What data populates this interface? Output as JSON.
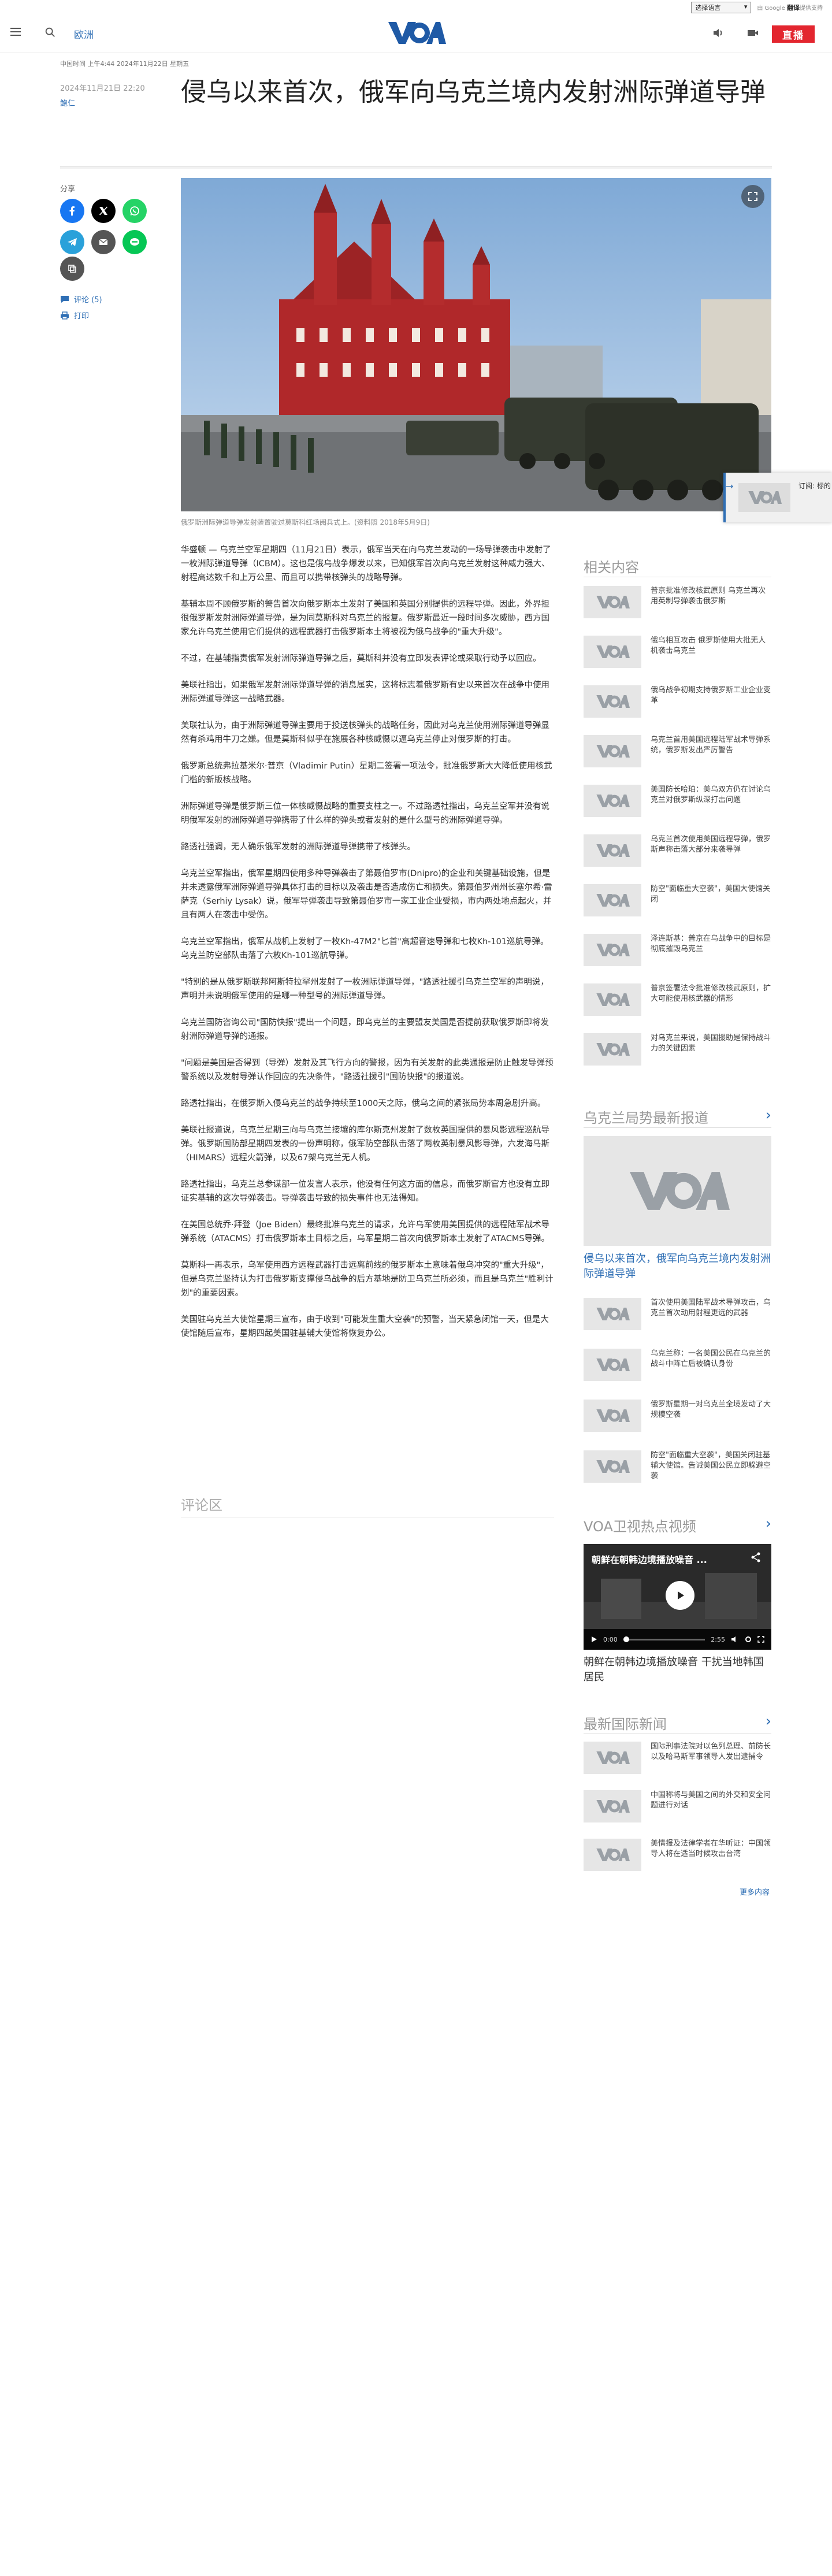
{
  "translate_bar": {
    "select_label": "选择语言",
    "powered": "由 Google ",
    "translate": "翻译",
    "powered_suffix": "提供支持"
  },
  "header": {
    "section": "欧洲",
    "logo": "VOA",
    "live_label": "直播"
  },
  "article": {
    "dateline": "中国时间 上午4:44 2024年11月22日 星期五",
    "date": "2024年11月21日 22:20",
    "author": "鲍仁",
    "title": "侵乌以来首次，俄军向乌克兰境内发射洲际弹道导弹",
    "caption": "俄罗斯洲际弹道导弹发射装置驶过莫斯科红场阅兵式上。(资料照 2018年5月9日)",
    "paragraphs": [
      "华盛顿 — 乌克兰空军星期四（11月21日）表示，俄军当天在向乌克兰发动的一场导弹袭击中发射了一枚洲际弹道导弹（ICBM）。这也是俄乌战争爆发以来，已知俄军首次向乌克兰发射这种威力强大、射程高达数千和上万公里、而且可以携带核弹头的战略导弹。",
      "基辅本周不顾俄罗斯的警告首次向俄罗斯本土发射了美国和英国分别提供的远程导弹。因此，外界担很俄罗斯发射洲际弹道导弹，是为同莫斯科对乌克兰的报复。俄罗斯最近一段时间多次威胁，西方国家允许乌克兰使用它们提供的远程武器打击俄罗斯本土将被视为俄乌战争的\"重大升级\"。",
      "不过，在基辅指责俄军发射洲际弹道导弹之后，莫斯科并没有立即发表评论或采取行动予以回应。",
      "美联社指出，如果俄军发射洲际弹道导弹的消息属实，这将标志着俄罗斯有史以来首次在战争中使用洲际弹道导弹这一战略武器。",
      "美联社认为，由于洲际弹道导弹主要用于投送核弹头的战略任务，因此对乌克兰使用洲际弹道导弹显然有杀鸡用牛刀之嫌。但是莫斯科似乎在施展各种核威慑以逼乌克兰停止对俄罗斯的打击。",
      "俄罗斯总统弗拉基米尔·普京（Vladimir Putin）星期二签署一项法令，批准俄罗斯大大降低使用核武门槛的新版核战略。",
      "洲际弹道导弹是俄罗斯三位一体核威慑战略的重要支柱之一。不过路透社指出，乌克兰空军并没有说明俄军发射的洲际弹道导弹携带了什么样的弹头或者发射的是什么型号的洲际弹道导弹。",
      "路透社强调，无人确乐俄军发射的洲际弹道导弹携带了核弹头。",
      "乌克兰空军指出，俄军星期四使用多种导弹袭击了第聂伯罗市(Dnipro)的企业和关键基础设施，但是并未透露俄军洲际弹道导弹具体打击的目标以及袭击是否造成伤亡和损失。第聂伯罗州州长塞尔希·雷萨克（Serhiy Lysak）说，俄军导弹袭击导致第聂伯罗市一家工业企业受损，市内两处地点起火，并且有两人在袭击中受伤。",
      "乌克兰空军指出，俄军从战机上发射了一枚Kh-47M2\"匕首\"高超音速导弹和七枚Kh-101巡航导弹。乌克兰防空部队击落了六枚Kh-101巡航导弹。",
      "\"特别的是从俄罗斯联邦阿斯特拉罕州发射了一枚洲际弹道导弹，\"路透社援引乌克兰空军的声明说，声明并未说明俄军使用的是哪一种型号的洲际弹道导弹。",
      "乌克兰国防咨询公司\"国防快报\"提出一个问题，即乌克兰的主要盟友美国是否提前获取俄罗斯即将发射洲际弹道导弹的通报。",
      "\"问题是美国是否得到（导弹）发射及其飞行方向的警报，因为有关发射的此类通报是防止触发导弹预警系统以及发射导弹认作回应的先决条件，\"路透社援引\"国防快报\"的报道说。",
      "路透社指出，在俄罗斯入侵乌克兰的战争持续至1000天之际，俄乌之间的紧张局势本周急剧升高。",
      "美联社报道说，乌克兰星期三向与乌克兰接壤的库尔斯克州发射了数枚英国提供的暴风影远程巡航导弹。俄罗斯国防部星期四发表的一份声明称，俄军防空部队击落了两枚英制暴风影导弹，六发海马斯（HIMARS）远程火箭弹，以及67架乌克兰无人机。",
      "路透社指出，乌克兰总参谋部一位发言人表示，他没有任何这方面的信息，而俄罗斯官方也没有立即证实基辅的这次导弹袭击。导弹袭击导致的损失事件也无法得知。",
      "在美国总统乔·拜登（Joe Biden）最终批准乌克兰的请求，允许乌军使用美国提供的远程陆军战术导弹系统（ATACMS）打击俄罗斯本土目标之后，乌军星期二首次向俄罗斯本土发射了ATACMS导弹。",
      "莫斯科一再表示，乌军使用西方远程武器打击远离前线的俄罗斯本土意味着俄乌冲突的\"重大升级\"，但是乌克兰坚持认为打击俄罗斯支撑侵乌战争的后方基地是防卫乌克兰所必须，而且是乌克兰\"胜利计划\"的重要因素。",
      "美国驻乌克兰大使馆星期三宣布，由于收到\"可能发生重大空袭\"的预警，当天紧急闭馆一天，但是大使馆随后宣布，星期四起美国驻基辅大使馆将恢复办公。"
    ],
    "comments_heading": "评论区"
  },
  "share": {
    "label": "分享",
    "comments_link": "评论 (5)",
    "print_link": "打印"
  },
  "sidebar": {
    "related_heading": "相关内容",
    "related": [
      "普京批准修改核武原则 乌克兰再次用英制导弹袭击俄罗斯",
      "俄乌相互攻击 俄罗斯使用大批无人机袭击乌克兰",
      "俄乌战争初期支持俄罗斯工业企业变革",
      "乌克兰首用美国远程陆军战术导弹系统，俄罗斯发出严厉警告",
      "美国防长哈珀：美乌双方仍在讨论乌克兰对俄罗斯纵深打击问题",
      "乌克兰首次使用美国远程导弹，俄罗斯声称击落大部分来袭导弹",
      "防空\"面临重大空袭\"，美国大使馆关闭",
      "泽连斯基：普京在乌战争中的目标是彻底摧毁乌克兰",
      "普京签署法令批准修改核武原则，扩大可能使用核武器的情形",
      "对乌克兰来说，美国援助是保持战斗力的关键因素"
    ],
    "latest_heading": "乌克兰局势最新报道",
    "latest_big_title": "侵乌以来首次，俄军向乌克兰境内发射洲际弹道导弹",
    "latest": [
      "首次使用美国陆军战术导弹攻击，乌克兰首次动用射程更远的武器",
      "乌克兰称：一名美国公民在乌克兰的战斗中阵亡后被确认身份",
      "俄罗斯星期一对乌克兰全境发动了大规模空袭",
      "防空\"面临重大空袭\"，美国关闭驻基辅大使馆。告诫美国公民立即躲避空袭"
    ],
    "video_heading": "VOA卫视热点视频",
    "video_title": "朝鲜在朝韩边境播放噪音 ...",
    "video_time": "0:00",
    "video_duration": "2:55",
    "video_caption": "朝鲜在朝韩边境播放噪音 干扰当地韩国居民",
    "world_heading": "最新国际新闻",
    "world": [
      "国际刑事法院对以色列总理、前防长以及哈马斯军事领导人发出逮捕令",
      "中国称将与美国之间的外交和安全问题进行对话",
      "美情报及法律学者在华听证：中国领导人将在适当时候攻击台湾"
    ],
    "more_label": "更多内容",
    "floating_label": "订阅: 标的"
  },
  "colors": {
    "accent": "#2f6fb5",
    "live_red": "#e3262f",
    "facebook": "#1877f2",
    "x": "#000000",
    "whatsapp": "#25d366",
    "telegram": "#2aa1da",
    "line": "#06c755"
  }
}
